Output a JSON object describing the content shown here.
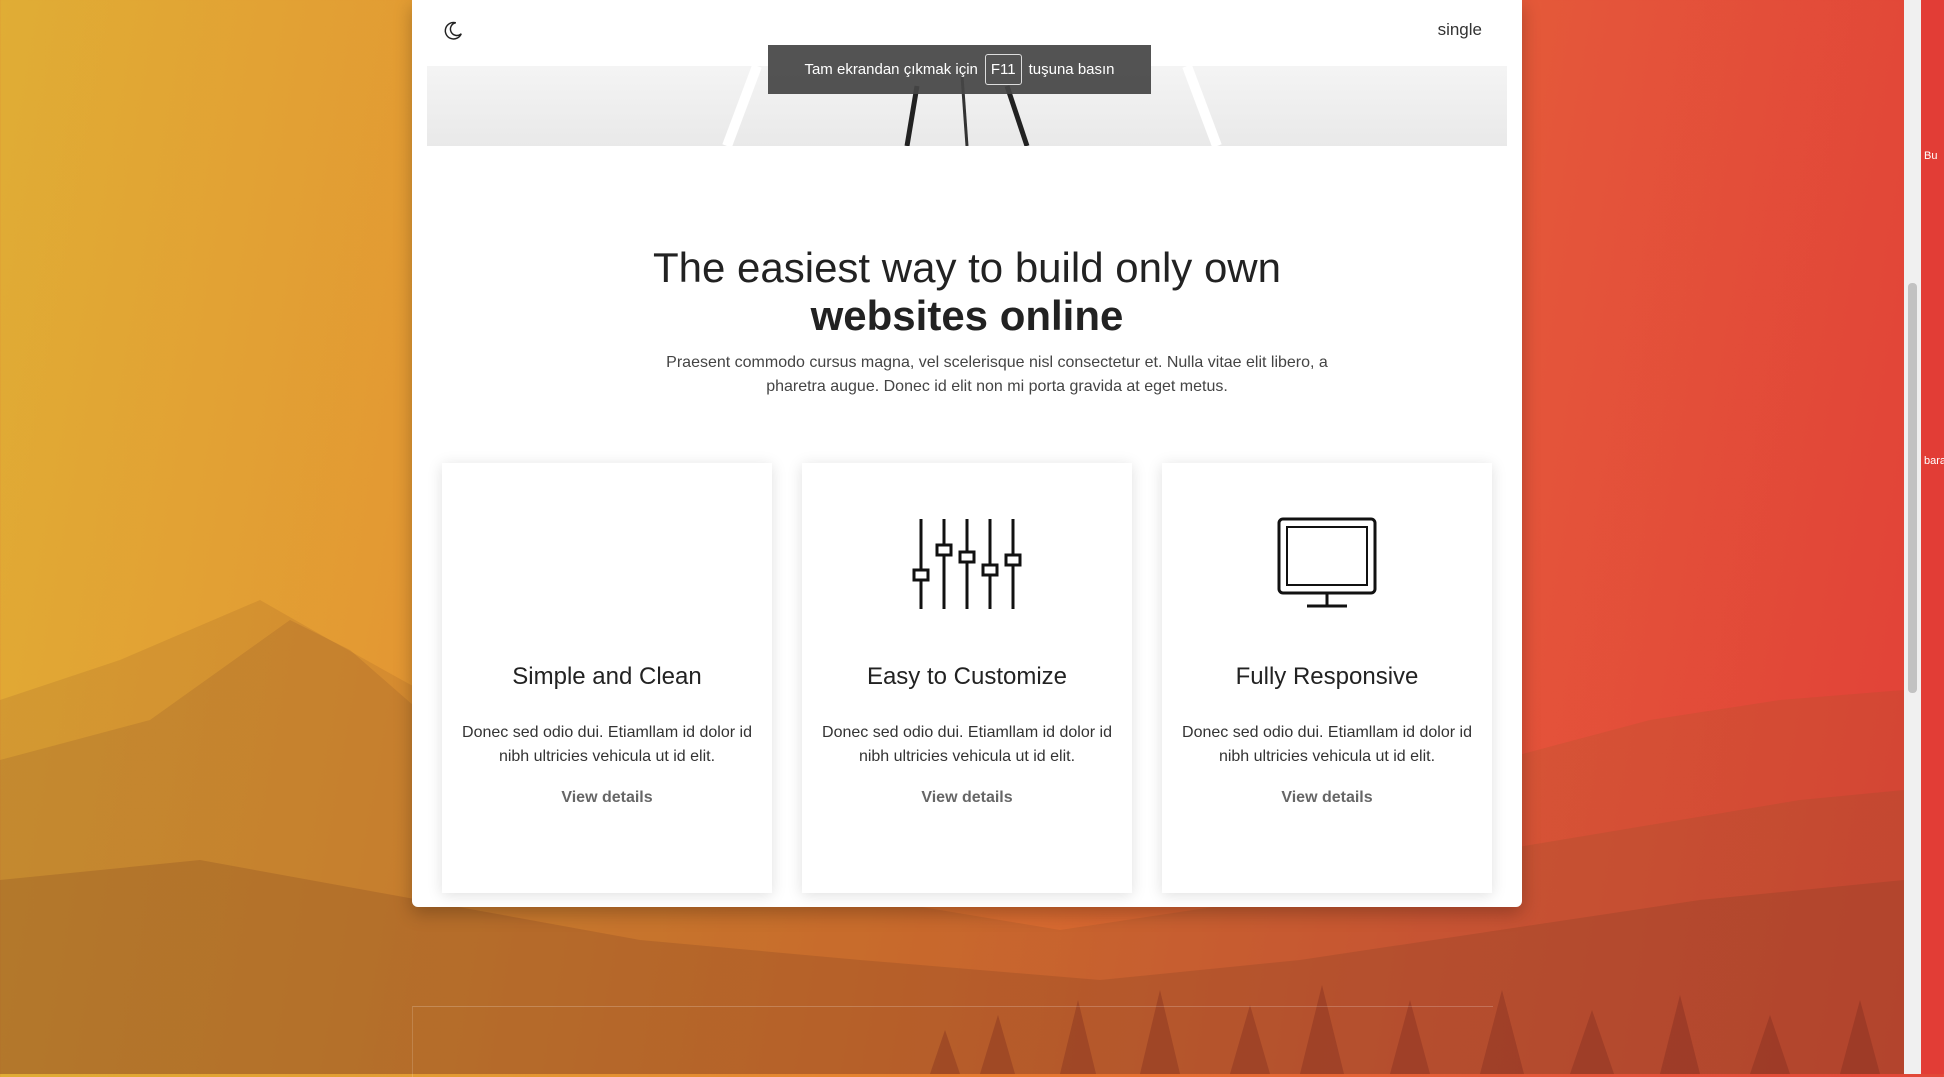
{
  "nav": {
    "link_label": "single"
  },
  "fullscreen_toast": {
    "before": "Tam ekrandan çıkmak için",
    "key": "F11",
    "after": "tuşuna basın"
  },
  "hero": {
    "heading_line1": "The easiest way to build only own",
    "heading_line2": "websites online",
    "subtext": "Praesent commodo cursus magna, vel scelerisque nisl consectetur et. Nulla vitae elit libero, a pharetra augue. Donec id elit non mi porta gravida at eget metus."
  },
  "features": [
    {
      "title": "Simple and Clean",
      "text": "Donec sed odio dui. Etiamllam id dolor id nibh ultricies vehicula ut id elit.",
      "link": "View details",
      "icon": "blank-icon"
    },
    {
      "title": "Easy to Customize",
      "text": "Donec sed odio dui. Etiamllam id dolor id nibh ultricies vehicula ut id elit.",
      "link": "View details",
      "icon": "sliders-icon"
    },
    {
      "title": "Fully Responsive",
      "text": "Donec sed odio dui. Etiamllam id dolor id nibh ultricies vehicula ut id elit.",
      "link": "View details",
      "icon": "monitor-icon"
    }
  ],
  "desktop_icons": [
    {
      "label": "Bu"
    },
    {
      "label": "bara"
    }
  ],
  "colors": {
    "background_start": "#e0ad35",
    "background_end": "#e13f37",
    "toast_bg": "#464646"
  }
}
